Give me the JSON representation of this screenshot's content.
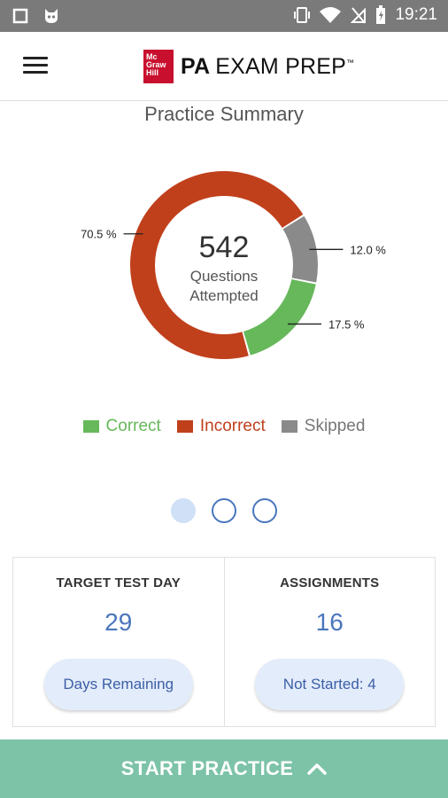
{
  "status_bar": {
    "time": "19:21"
  },
  "app_bar": {
    "logo_lines": [
      "Mc",
      "Graw",
      "Hill"
    ],
    "brand_bold": "PA",
    "brand_rest": "EXAM PREP",
    "trademark": "™"
  },
  "summary": {
    "title": "Practice Summary"
  },
  "chart_data": {
    "type": "pie",
    "center_value": "542",
    "center_label_1": "Questions",
    "center_label_2": "Attempted",
    "slices": [
      {
        "name": "Incorrect",
        "value": 70.5,
        "label": "70.5 %",
        "color": "#c0401c"
      },
      {
        "name": "Skipped",
        "value": 12.0,
        "label": "12.0 %",
        "color": "#8a8a8a"
      },
      {
        "name": "Correct",
        "value": 17.5,
        "label": "17.5 %",
        "color": "#66b85a"
      }
    ],
    "legend": [
      "Correct",
      "Incorrect",
      "Skipped"
    ]
  },
  "legend_colors": {
    "correct": "#66b85a",
    "incorrect": "#c0401c",
    "skipped": "#8a8a8a"
  },
  "cards": {
    "target": {
      "title": "TARGET TEST DAY",
      "value": "29",
      "button": "Days Remaining"
    },
    "assignments": {
      "title": "ASSIGNMENTS",
      "value": "16",
      "button": "Not Started: 4"
    }
  },
  "start_button": {
    "label": "START PRACTICE"
  }
}
